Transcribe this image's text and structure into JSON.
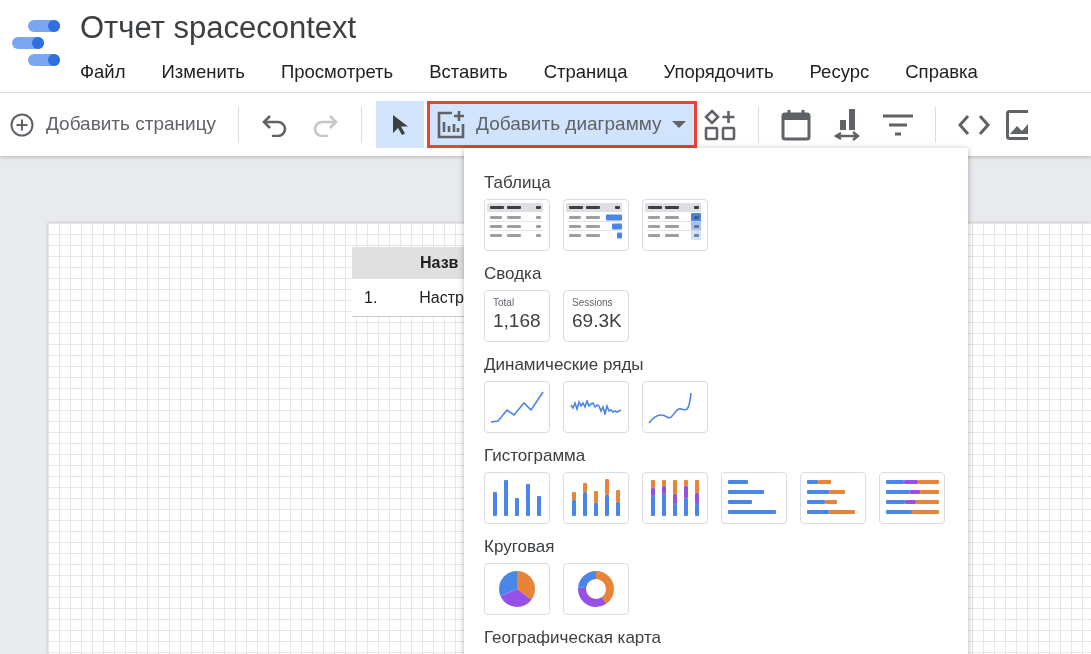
{
  "report_title": "Отчет spacecontext",
  "menu": [
    "Файл",
    "Изменить",
    "Просмотреть",
    "Вставить",
    "Страница",
    "Упорядочить",
    "Ресурс",
    "Справка"
  ],
  "toolbar": {
    "add_page": "Добавить страницу",
    "undo": {
      "disabled": false
    },
    "redo": {
      "disabled": true
    },
    "select_tool": {
      "selected": true
    },
    "add_chart": {
      "label": "Добавить диаграмму",
      "selected": true,
      "outlined": true
    }
  },
  "canvas_table": {
    "header": "Назв",
    "rows": [
      {
        "index": "1.",
        "name": "Настр"
      }
    ]
  },
  "chart_menu": [
    {
      "title": "Таблица",
      "options": [
        {
          "kind": "table"
        },
        {
          "kind": "table-bars"
        },
        {
          "kind": "table-heatmap"
        }
      ]
    },
    {
      "title": "Сводка",
      "options": [
        {
          "kind": "scorecard",
          "label": "Total",
          "value": "1,168"
        },
        {
          "kind": "scorecard",
          "label": "Sessions",
          "value": "69.3K"
        }
      ]
    },
    {
      "title": "Динамические ряды",
      "options": [
        {
          "kind": "line"
        },
        {
          "kind": "line-noisy"
        },
        {
          "kind": "line-smooth"
        }
      ]
    },
    {
      "title": "Гистограмма",
      "options": [
        {
          "kind": "column"
        },
        {
          "kind": "column-stacked"
        },
        {
          "kind": "column-stacked-100"
        },
        {
          "kind": "bar"
        },
        {
          "kind": "bar-stacked"
        },
        {
          "kind": "bar-stacked-100"
        }
      ]
    },
    {
      "title": "Круговая",
      "options": [
        {
          "kind": "pie"
        },
        {
          "kind": "donut"
        }
      ]
    },
    {
      "title": "Географическая карта"
    }
  ]
}
